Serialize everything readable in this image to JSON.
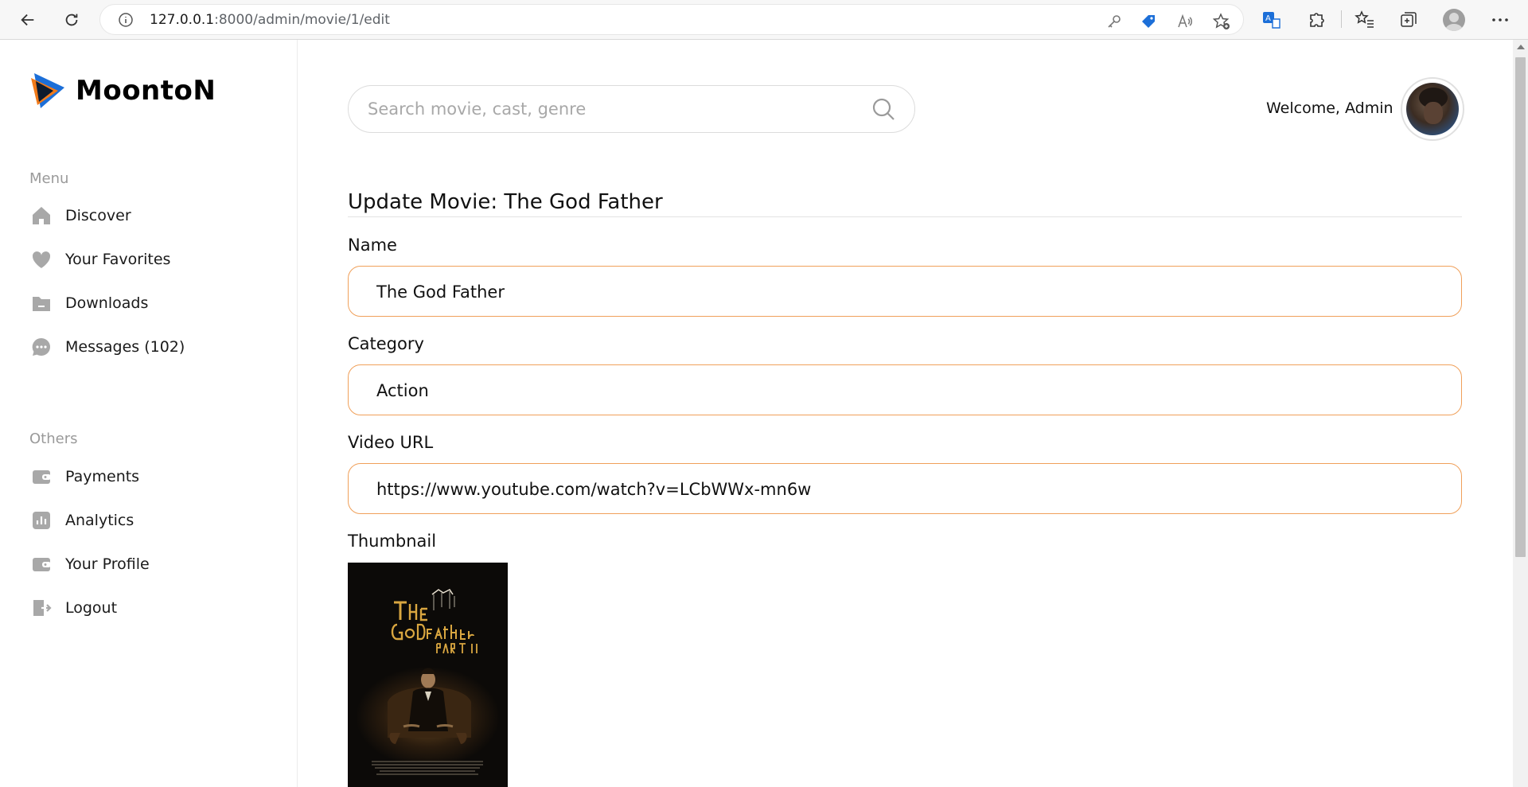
{
  "browser": {
    "url_host": "127.0.0.1",
    "url_path": ":8000/admin/movie/1/edit"
  },
  "sidebar": {
    "logo_text": "MoontoN",
    "menu_label": "Menu",
    "menu_items": [
      {
        "label": "Discover",
        "icon": "home-icon"
      },
      {
        "label": "Your Favorites",
        "icon": "heart-icon"
      },
      {
        "label": "Downloads",
        "icon": "folder-icon"
      },
      {
        "label": "Messages (102)",
        "icon": "chat-icon"
      }
    ],
    "others_label": "Others",
    "others_items": [
      {
        "label": "Payments",
        "icon": "wallet-icon"
      },
      {
        "label": "Analytics",
        "icon": "bar-chart-icon"
      },
      {
        "label": "Your Profile",
        "icon": "wallet-icon"
      },
      {
        "label": "Logout",
        "icon": "logout-icon"
      }
    ]
  },
  "header": {
    "search_placeholder": "Search movie, cast, genre",
    "welcome": "Welcome, Admin"
  },
  "form": {
    "title": "Update Movie: The God Father",
    "name_label": "Name",
    "name_value": "The God Father",
    "category_label": "Category",
    "category_value": "Action",
    "video_url_label": "Video URL",
    "video_url_value": "https://www.youtube.com/watch?v=LCbWWx-mn6w",
    "thumbnail_label": "Thumbnail"
  },
  "colors": {
    "accent": "#f0a05a",
    "logo_blue": "#1c6fd8",
    "logo_orange": "#f07a1a"
  }
}
